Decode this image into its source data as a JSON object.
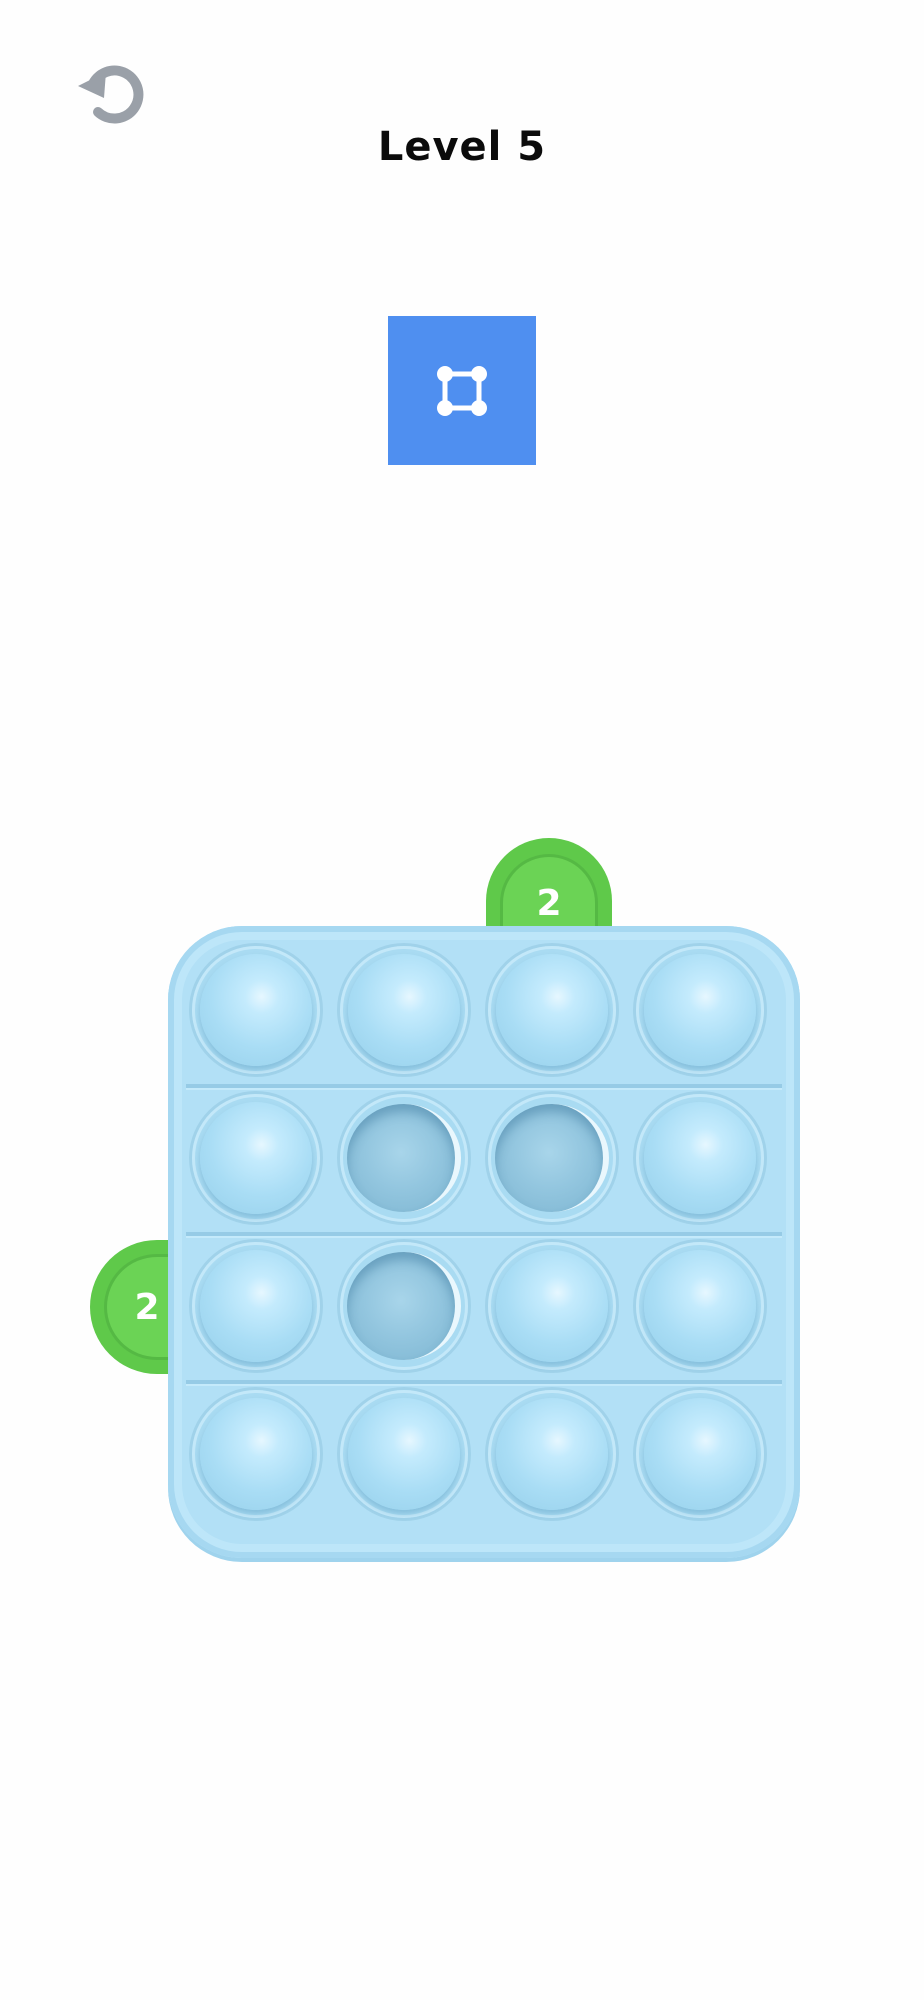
{
  "header": {
    "title": "Level 5"
  },
  "icons": {
    "restart": "restart-arrow-icon",
    "shape": "square-nodes-icon"
  },
  "colors": {
    "card": "#4f8ff0",
    "tab_green": "#5fc94a",
    "board": "#b2e0f6",
    "icon_gray": "#9aa0a8"
  },
  "clues": {
    "top": "2",
    "left": "2"
  },
  "board": {
    "rows": 4,
    "cols": 4,
    "popped": [
      [
        1,
        1
      ],
      [
        1,
        2
      ],
      [
        2,
        1
      ]
    ]
  }
}
